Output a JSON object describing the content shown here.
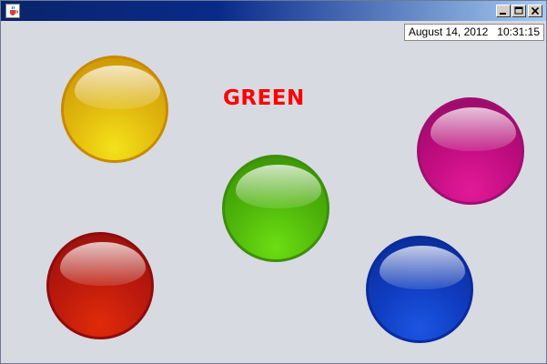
{
  "window": {
    "title": "",
    "icon": "java-coffee-cup-icon",
    "controls": [
      "minimize-icon",
      "maximize-icon",
      "close-icon"
    ]
  },
  "clock": {
    "date": "August 14, 2012",
    "time": "10:31:15"
  },
  "selected_color_label": {
    "text": "GREEN",
    "color": "#ff0000"
  },
  "balls": [
    {
      "name": "yellow",
      "color": "#e0b80d"
    },
    {
      "name": "green",
      "color": "#4fb70b"
    },
    {
      "name": "magenta",
      "color": "#c10d80"
    },
    {
      "name": "red",
      "color": "#bd1a0c"
    },
    {
      "name": "blue",
      "color": "#0f3cc0"
    }
  ]
}
